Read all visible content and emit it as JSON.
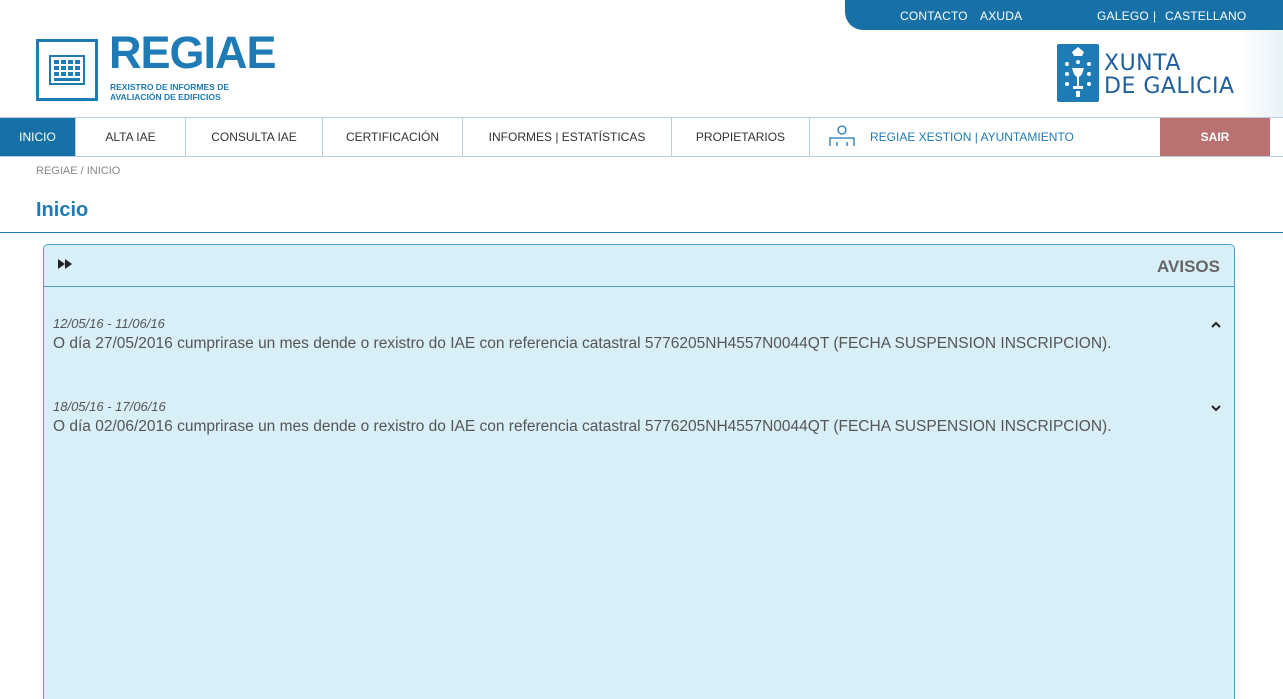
{
  "topbar": {
    "contacto": "CONTACTO",
    "axuda": "AXUDA",
    "galego": "GALEGO",
    "separator": "|",
    "castellano": "CASTELLANO"
  },
  "logo": {
    "title": "REGIAE",
    "subtitle_line1": "REXISTRO DE INFORMES DE",
    "subtitle_line2": "AVALIACIÓN DE EDIFICIOS"
  },
  "xunta": {
    "line1": "XUNTA",
    "line2": "DE GALICIA"
  },
  "nav": {
    "items": [
      {
        "label": "INICIO"
      },
      {
        "label": "ALTA IAE"
      },
      {
        "label": "CONSULTA IAE"
      },
      {
        "label": "CERTIFICACIÓN"
      },
      {
        "label": "INFORMES | ESTATÍSTICAS"
      },
      {
        "label": "PROPIETARIOS"
      }
    ],
    "xestion_label": "REGIAE XESTION | AYUNTAMIENTO",
    "sair_label": "SAIR"
  },
  "breadcrumb": "REGIAE / INICIO",
  "page_title": "Inicio",
  "avisos": {
    "toggle_icon": "fast-forward-icon",
    "title": "AVISOS",
    "items": [
      {
        "dates": "12/05/16 - 11/06/16",
        "message": "O día 27/05/2016 cumprirase un mes dende o rexistro do IAE con referencia catastral 5776205NH4557N0044QT (FECHA SUSPENSION INSCRIPCION).",
        "expanded": true,
        "chevron": "chevron-up-icon"
      },
      {
        "dates": "18/05/16 - 17/06/16",
        "message": "O día 02/06/2016 cumprirase un mes dende o rexistro do IAE con referencia catastral 5776205NH4557N0044QT (FECHA SUSPENSION INSCRIPCION).",
        "expanded": false,
        "chevron": "chevron-down-icon"
      }
    ]
  },
  "colors": {
    "brand_blue": "#1770a6",
    "logo_blue": "#1f7bb5",
    "panel_bg": "#d9eff8",
    "sair_bg": "#b97172"
  }
}
